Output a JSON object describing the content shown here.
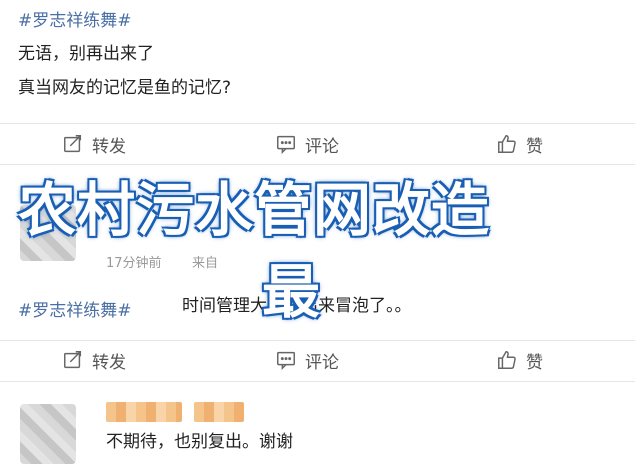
{
  "post1": {
    "hashtag": "#罗志祥练舞#",
    "line1": "无语，别再出来了",
    "line2": "真当网友的记忆是鱼的记忆?"
  },
  "actions": {
    "repost": "转发",
    "comment": "评论",
    "like": "赞"
  },
  "overlay": {
    "title": "农村污水管网改造",
    "sub": "最"
  },
  "post2": {
    "time": "17分钟前",
    "source": "来自",
    "hashtag": "#罗志祥练舞#",
    "text": "时间管理大师又出来冒泡了。。"
  },
  "post3": {
    "text": "不期待，也别复出。谢谢"
  },
  "colors": {
    "hashtag": "#4a6fa5",
    "overlay_outline": "#1a5fb4"
  }
}
